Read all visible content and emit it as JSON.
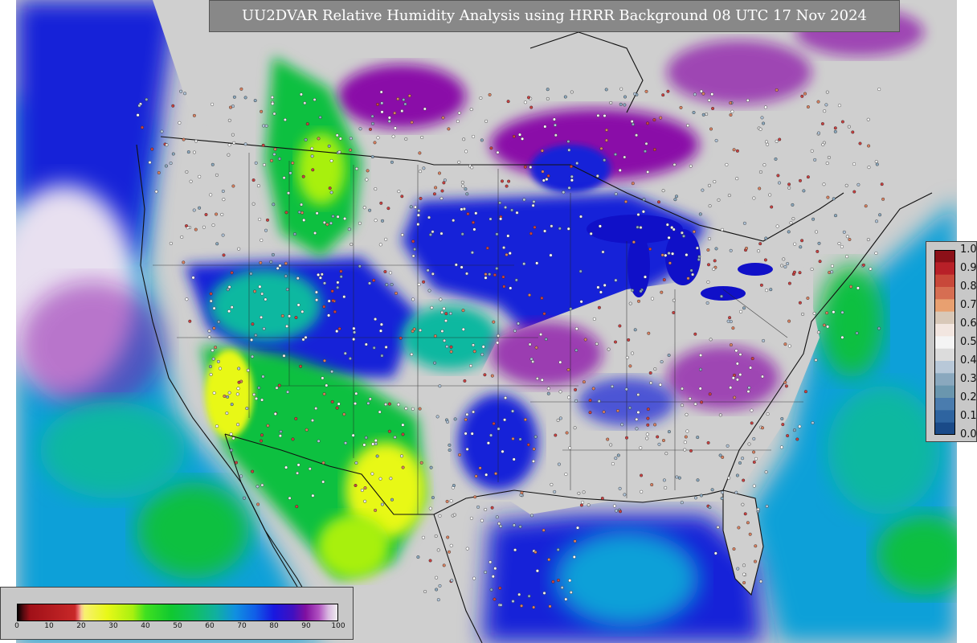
{
  "title": "UU2DVAR Relative Humidity Analysis using HRRR Background 08 UTC 17 Nov 2024",
  "obs_legend": {
    "labels": [
      "1.0",
      "0.9",
      "0.8",
      "0.7",
      "0.6",
      "0.5",
      "0.4",
      "0.3",
      "0.2",
      "0.1",
      "0.0"
    ],
    "colors": [
      "#8c1018",
      "#b82028",
      "#c8483a",
      "#d66e52",
      "#e8a070",
      "#d8c8b8",
      "#f2e6e0",
      "#f4f4f4",
      "#dcdcdc",
      "#b8c8d8",
      "#8aa8be",
      "#6a96ae",
      "#4a7cae",
      "#2e64a0",
      "#1a4a88"
    ]
  },
  "rh_legend": {
    "ticks": [
      "0",
      "10",
      "20",
      "30",
      "40",
      "50",
      "60",
      "70",
      "80",
      "90",
      "100"
    ],
    "stops": [
      {
        "v": 0,
        "c": "#000000"
      },
      {
        "v": 2,
        "c": "#5a0a10"
      },
      {
        "v": 4,
        "c": "#a01018"
      },
      {
        "v": 18,
        "c": "#c82828"
      },
      {
        "v": 19,
        "c": "#e86868"
      },
      {
        "v": 20,
        "c": "#f8c890"
      },
      {
        "v": 21,
        "c": "#f8f070"
      },
      {
        "v": 28,
        "c": "#e8f818"
      },
      {
        "v": 36,
        "c": "#a8f010"
      },
      {
        "v": 40,
        "c": "#40e020"
      },
      {
        "v": 48,
        "c": "#10c830"
      },
      {
        "v": 55,
        "c": "#10c060"
      },
      {
        "v": 62,
        "c": "#10b0a0"
      },
      {
        "v": 68,
        "c": "#1090e0"
      },
      {
        "v": 74,
        "c": "#1060e8"
      },
      {
        "v": 80,
        "c": "#1818e0"
      },
      {
        "v": 86,
        "c": "#4010c0"
      },
      {
        "v": 90,
        "c": "#8010a0"
      },
      {
        "v": 94,
        "c": "#b050c0"
      },
      {
        "v": 97,
        "c": "#d8b8e0"
      },
      {
        "v": 100,
        "c": "#f0f0f0"
      }
    ]
  },
  "colors": {
    "land_moist": "#cfcfcf",
    "purple": "#8a10a8",
    "blue": "#1820d8",
    "deep_blue": "#1010c8",
    "cyan": "#10a0d8",
    "teal": "#10b8a0",
    "green": "#10c040",
    "yellow_green": "#a8f010",
    "yellow": "#e8f818",
    "lavender": "#e8e0f0"
  }
}
